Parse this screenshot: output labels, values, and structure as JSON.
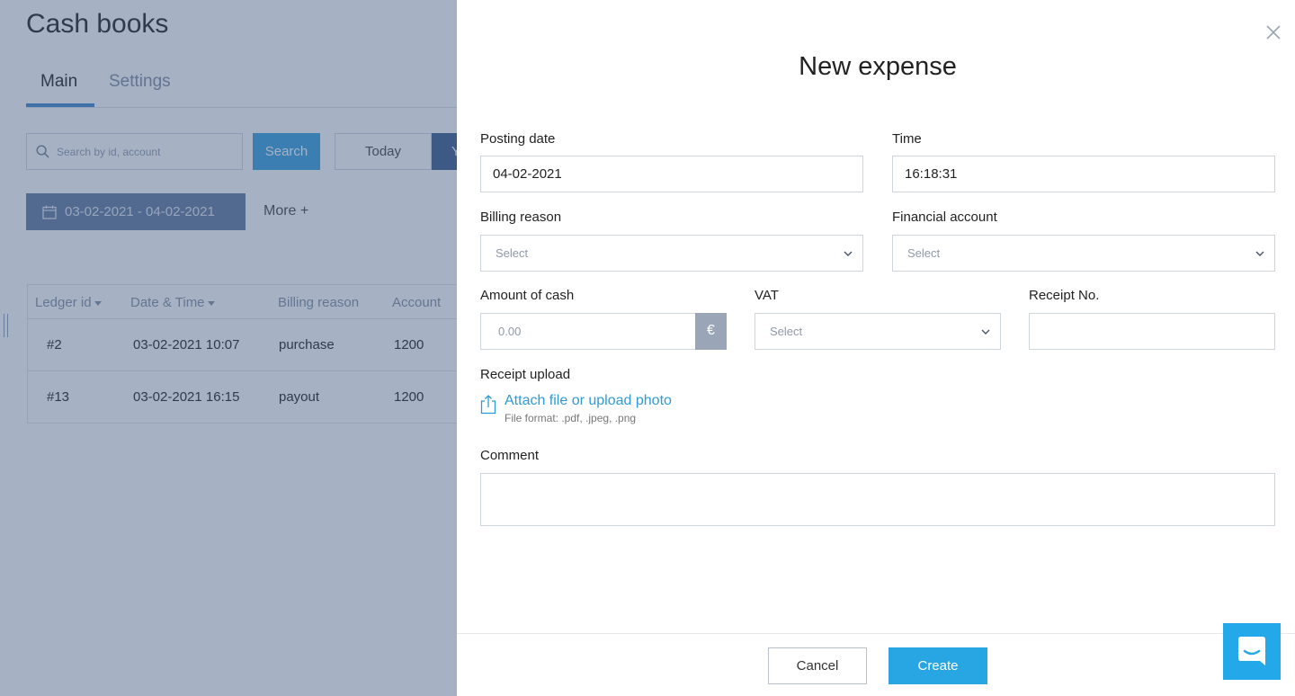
{
  "background": {
    "page_title": "Cash books",
    "tabs": [
      {
        "label": "Main"
      },
      {
        "label": "Settings"
      }
    ],
    "search": {
      "placeholder": "Search by id, account",
      "button": "Search"
    },
    "period_buttons": {
      "today": "Today",
      "yesterday_partial": "Y"
    },
    "date_range": "03-02-2021 - 04-02-2021",
    "more_filters": "More +",
    "table": {
      "headers": [
        "Ledger id",
        "Date & Time",
        "Billing reason",
        "Account"
      ],
      "rows": [
        [
          "#2",
          "03-02-2021 10:07",
          "purchase",
          "1200"
        ],
        [
          "#13",
          "03-02-2021 16:15",
          "payout",
          "1200"
        ]
      ]
    }
  },
  "modal": {
    "title": "New expense",
    "posting_date": {
      "label": "Posting date",
      "value": "04-02-2021"
    },
    "time": {
      "label": "Time",
      "value": "16:18:31"
    },
    "billing_reason": {
      "label": "Billing reason",
      "placeholder": "Select"
    },
    "financial_account": {
      "label": "Financial account",
      "placeholder": "Select"
    },
    "amount": {
      "label": "Amount of cash",
      "placeholder": "0.00",
      "currency": "€"
    },
    "vat": {
      "label": "VAT",
      "placeholder": "Select"
    },
    "receipt_no": {
      "label": "Receipt No.",
      "value": ""
    },
    "receipt_upload": {
      "label": "Receipt upload",
      "link": "Attach file or upload photo",
      "hint": "File format: .pdf, .jpeg, .png"
    },
    "comment": {
      "label": "Comment",
      "value": ""
    },
    "buttons": {
      "cancel": "Cancel",
      "create": "Create"
    }
  },
  "colors": {
    "accent": "#28a6e3",
    "link": "#2e9bd6",
    "overlay": "#2b4673"
  },
  "icons": [
    "search-icon",
    "calendar-icon",
    "close-icon",
    "chevron-down-icon",
    "upload-icon",
    "chat-icon"
  ]
}
